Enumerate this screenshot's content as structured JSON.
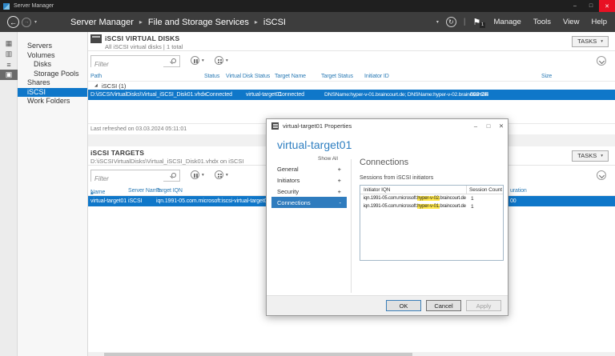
{
  "colors": {
    "selection_blue": "#0f77c9",
    "dialog_nav_blue": "#2f7cbe",
    "column_header_blue": "#2a7ab5",
    "dialog_heading_blue": "#2f7fc1",
    "highlight_yellow": "#ffe74a",
    "close_button_red": "#e81123",
    "titlebar_dark": "#1f1f1f",
    "navbar_dark": "#3d3d3d"
  },
  "icons": {
    "back": "←",
    "forward": "→",
    "caret": "▾",
    "refresh": "↻",
    "flag": "⚑",
    "breadcrumb_sep": "▸",
    "dashboard": "▦",
    "local_server": "▥",
    "all_servers": "≡",
    "file_storage": "▣",
    "strip_expand": "▸",
    "sort_asc": "▴",
    "group_triangle": "◢",
    "minimize": "–",
    "maximize": "□",
    "close": "✕"
  },
  "window": {
    "title": "Server Manager"
  },
  "navbar": {
    "breadcrumb": [
      "Server Manager",
      "File and Storage Services",
      "iSCSI"
    ],
    "flag_badge": "1",
    "menu": [
      {
        "label": "Manage"
      },
      {
        "label": "Tools"
      },
      {
        "label": "View"
      },
      {
        "label": "Help"
      }
    ]
  },
  "sidebar": {
    "items": [
      {
        "label": "Servers"
      },
      {
        "label": "Volumes"
      },
      {
        "label": "Disks"
      },
      {
        "label": "Storage Pools"
      },
      {
        "label": "Shares"
      },
      {
        "label": "iSCSI"
      },
      {
        "label": "Work Folders"
      }
    ]
  },
  "virtual_disks": {
    "title": "iSCSI VIRTUAL DISKS",
    "subtitle": "All iSCSI virtual disks | 1 total",
    "tasks_label": "TASKS",
    "filter_placeholder": "Filter",
    "columns": [
      "Path",
      "Status",
      "Virtual Disk Status",
      "Target Name",
      "Target Status",
      "Initiator ID",
      "Size"
    ],
    "group_label": "iSCSI (1)",
    "row": {
      "path": "D:\\iSCSIVirtualDisks\\Virtual_iSCSI_Disk01.vhdx",
      "status": "",
      "virtual_disk_status": "Connected",
      "target_name": "virtual-target01",
      "target_status": "Connected",
      "initiator_id": "DNSName:hyper-v-01.braincourt.de; DNSName:hyper-v-02.braincourt.de",
      "size": "800 GB"
    },
    "last_refreshed": "Last refreshed on 03.03.2024 05:11:01"
  },
  "targets": {
    "title": "iSCSI TARGETS",
    "subtitle": "D:\\iSCSIVirtualDisks\\Virtual_iSCSI_Disk01.vhdx on iSCSI",
    "tasks_label": "TASKS",
    "filter_placeholder": "Filter",
    "columns": [
      "Name",
      "Server Name",
      "Target IQN"
    ],
    "partial_column_fragment": "uration",
    "row": {
      "name": "virtual-target01",
      "server_name": "iSCSI",
      "target_iqn": "iqn.1991-05.com.microsoft:iscsi-virtual-target01-target",
      "partial_cell_fragment": "00"
    }
  },
  "dialog": {
    "title": "virtual-target01 Properties",
    "heading": "virtual-target01",
    "show_all": "Show All",
    "nav": [
      {
        "label": "General",
        "toggle": "+"
      },
      {
        "label": "Initiators",
        "toggle": "+"
      },
      {
        "label": "Security",
        "toggle": "+"
      },
      {
        "label": "Connections",
        "toggle": "-"
      }
    ],
    "section_title": "Connections",
    "sessions_label": "Sessions from iSCSI initiators",
    "table": {
      "columns": [
        "Initiator IQN",
        "Session Count"
      ],
      "rows": [
        {
          "iqn_prefix": "iqn.1991-05.com.microsoft:",
          "iqn_highlight": "hyper-v-02.",
          "iqn_suffix": "braincourt.de",
          "session_count": "1"
        },
        {
          "iqn_prefix": "iqn.1991-05.com.microsoft:",
          "iqn_highlight": "hyper-v-01.",
          "iqn_suffix": "braincourt.de",
          "session_count": "1"
        }
      ]
    },
    "buttons": {
      "ok": "OK",
      "cancel": "Cancel",
      "apply": "Apply"
    }
  }
}
